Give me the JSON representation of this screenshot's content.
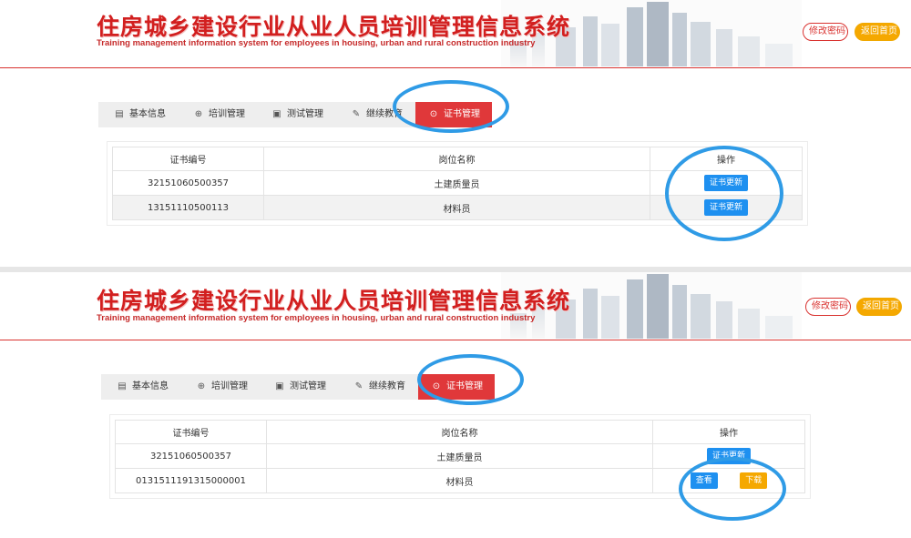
{
  "header": {
    "title_cn": "住房城乡建设行业从业人员培训管理信息系统",
    "title_en": "Training management information system for employees in housing, urban and rural construction industry",
    "change_password": "修改密码",
    "return_home": "返回首页"
  },
  "tabs": [
    {
      "label": "基本信息",
      "icon": "clipboard-icon"
    },
    {
      "label": "培训管理",
      "icon": "training-icon"
    },
    {
      "label": "测试管理",
      "icon": "document-icon"
    },
    {
      "label": "继续教育",
      "icon": "edit-icon"
    },
    {
      "label": "证书管理",
      "icon": "badge-icon"
    }
  ],
  "table": {
    "headers": [
      "证书编号",
      "岗位名称",
      "操作"
    ]
  },
  "panel1": {
    "rows": [
      {
        "cert_no": "32151060500357",
        "position": "土建质量员",
        "action": "证书更新"
      },
      {
        "cert_no": "13151110500113",
        "position": "材料员",
        "action": "证书更新"
      }
    ]
  },
  "panel2": {
    "rows": [
      {
        "cert_no": "32151060500357",
        "position": "土建质量员",
        "action": "证书更新"
      },
      {
        "cert_no": "0131511191315000001",
        "position": "材料员",
        "view": "查看",
        "download": "下载"
      }
    ]
  },
  "colors": {
    "brand_red": "#d9322f",
    "active_tab": "#e0383a",
    "accent_blue": "#1e90f0",
    "accent_orange": "#f5a800",
    "annotation_blue": "#2f9be6"
  }
}
